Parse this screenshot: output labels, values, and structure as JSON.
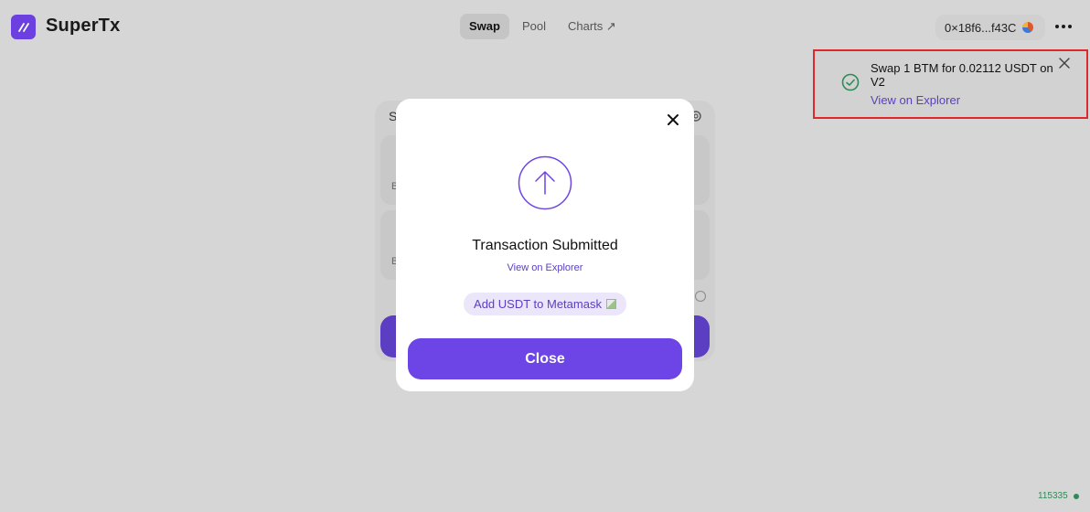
{
  "header": {
    "brand": "SuperTx",
    "nav": [
      {
        "label": "Swap"
      },
      {
        "label": "Pool"
      },
      {
        "label": "Charts ↗"
      }
    ],
    "wallet_address": "0×18f6...f43C"
  },
  "swap_card": {
    "title_initial": "S",
    "from_label_initial": "B",
    "to_label_initial": "B"
  },
  "modal": {
    "title": "Transaction Submitted",
    "explorer_link": "View on Explorer",
    "metamask_button": "Add USDT to Metamask",
    "close_button": "Close"
  },
  "toast": {
    "message": "Swap 1 BTM for 0.02112 USDT on V2",
    "link": "View on Explorer"
  },
  "footer": {
    "block_number": "115335"
  },
  "colors": {
    "accent": "#6d44e6",
    "success": "#2e8b57",
    "highlight_border": "#e0282a"
  }
}
